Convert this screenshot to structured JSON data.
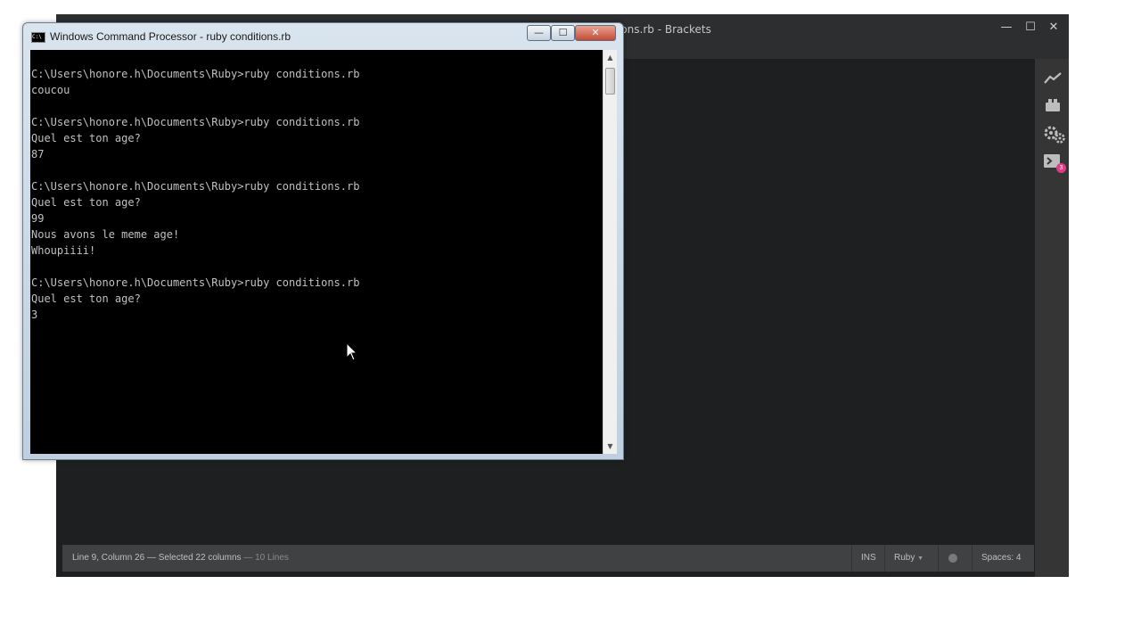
{
  "brackets": {
    "title": "ions.rb - Brackets",
    "controls": {
      "minimize": "—",
      "maximize": "☐",
      "close": "✕"
    },
    "rail_icons": [
      "live-preview-icon",
      "extension-manager-icon",
      "gear-icon",
      "terminal-icon"
    ],
    "notification_count": "3",
    "status": {
      "cursor_info": "Line 9, Column 26 — Selected 22 columns",
      "lines": " — 10 Lines",
      "mode": "INS",
      "language": "Ruby",
      "language_arrow": "▼",
      "indent": "Spaces:",
      "indent_value": "4"
    }
  },
  "cmd": {
    "title": "Windows Command Processor - ruby  conditions.rb",
    "icon_text": "C:\\",
    "buttons": {
      "minimize": "—",
      "maximize": "☐",
      "close": "✕"
    },
    "output": "C:\\Users\\honore.h\\Documents\\Ruby>ruby conditions.rb\ncoucou\n\nC:\\Users\\honore.h\\Documents\\Ruby>ruby conditions.rb\nQuel est ton age?\n87\n\nC:\\Users\\honore.h\\Documents\\Ruby>ruby conditions.rb\nQuel est ton age?\n99\nNous avons le meme age!\nWhoupiiii!\n\nC:\\Users\\honore.h\\Documents\\Ruby>ruby conditions.rb\nQuel est ton age?\n3",
    "scroll": {
      "up": "▲",
      "down": "▼"
    }
  },
  "colors": {
    "brackets_bg": "#1d1f21",
    "status_bar": "#404142",
    "badge": "#e23a85",
    "console_bg": "#000000",
    "console_text": "#c0c0c0"
  }
}
